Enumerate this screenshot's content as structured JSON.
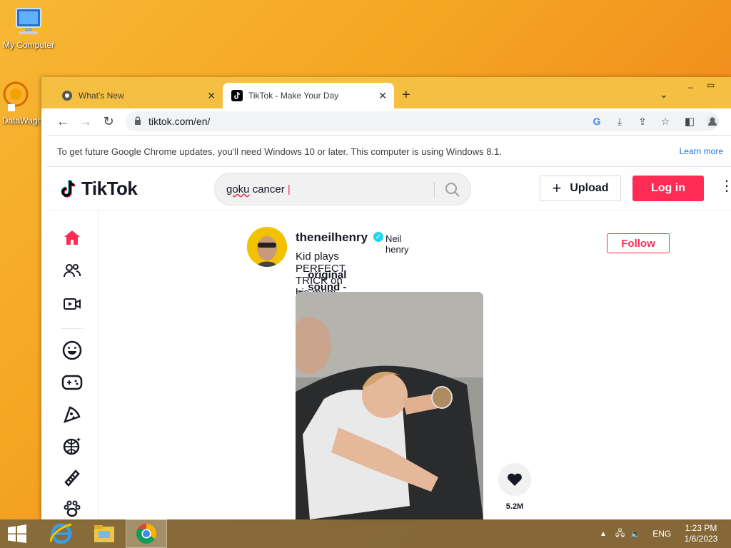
{
  "desktop": {
    "icons": [
      {
        "label": "My Computer"
      },
      {
        "label": "DataWago"
      }
    ]
  },
  "browser": {
    "tabs": [
      {
        "title": "What's New",
        "active": false
      },
      {
        "title": "TikTok - Make Your Day",
        "active": true
      }
    ],
    "url": "tiktok.com/en/",
    "infobar": {
      "message": "To get future Google Chrome updates, you'll need Windows 10 or later. This computer is using Windows 8.1.",
      "link": "Learn more"
    }
  },
  "tiktok": {
    "brand": "TikTok",
    "search": {
      "query_word1": "goku",
      "query_word2": " cancer"
    },
    "upload_label": "Upload",
    "login_label": "Log in",
    "brand_color": "#fe2c55",
    "sidebar": [
      "home-icon",
      "following-icon",
      "live-icon",
      "comedy-icon",
      "gaming-icon",
      "food-icon",
      "dance-icon",
      "beauty-icon",
      "animals-icon"
    ],
    "post": {
      "username": "theneilhenry",
      "nickname": "Neil henry",
      "caption": "Kid plays PERFECT TRICK on his mum...😂",
      "music": "original sound - Neil henry",
      "follow_label": "Follow",
      "likes": "5.2M"
    }
  },
  "taskbar": {
    "language": "ENG",
    "time": "1:23 PM",
    "date": "1/6/2023"
  }
}
